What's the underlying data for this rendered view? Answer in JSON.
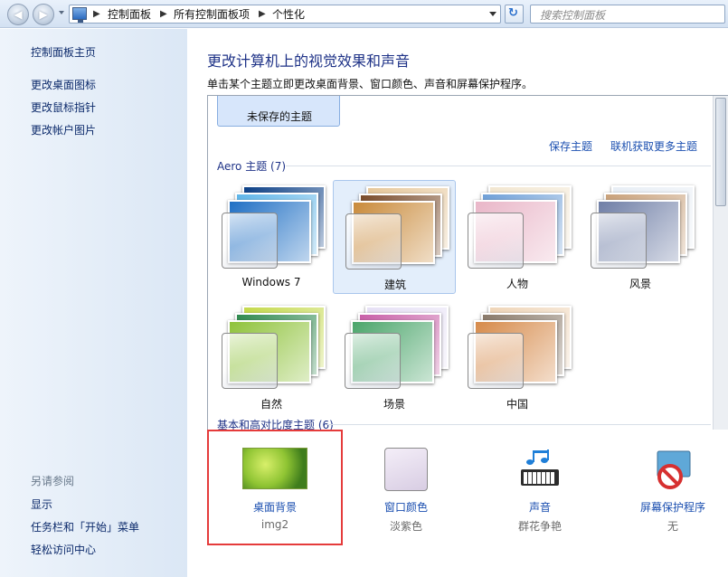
{
  "address": {
    "crumbs": [
      "控制面板",
      "所有控制面板项",
      "个性化"
    ],
    "search_placeholder": "搜索控制面板"
  },
  "sidebar": {
    "items": [
      {
        "label": "控制面板主页"
      },
      {
        "label": "更改桌面图标"
      },
      {
        "label": "更改鼠标指针"
      },
      {
        "label": "更改帐户图片"
      }
    ],
    "see_also_title": "另请参阅",
    "see_also": [
      {
        "label": "显示"
      },
      {
        "label": "任务栏和「开始」菜单"
      },
      {
        "label": "轻松访问中心"
      }
    ]
  },
  "main": {
    "title": "更改计算机上的视觉效果和声音",
    "description": "单击某个主题立即更改桌面背景、窗口颜色、声音和屏幕保护程序。",
    "unsaved_theme": "未保存的主题",
    "save_theme": "保存主题",
    "get_more": "联机获取更多主题",
    "aero_header": "Aero 主题 (7)",
    "aero_themes": [
      {
        "name": "Windows 7",
        "selected": false,
        "colors": [
          "#1f6fc4",
          "#5fb6e9",
          "#0b3f86"
        ]
      },
      {
        "name": "建筑",
        "selected": true,
        "colors": [
          "#c98a3a",
          "#7a4b2a",
          "#e6c79a"
        ]
      },
      {
        "name": "人物",
        "selected": false,
        "colors": [
          "#e9b6c8",
          "#6fa0d8",
          "#f2e6d0"
        ]
      },
      {
        "name": "风景",
        "selected": false,
        "colors": [
          "#6f7ea6",
          "#c9a17a",
          "#e8eef5"
        ]
      },
      {
        "name": "自然",
        "selected": false,
        "colors": [
          "#8ec23a",
          "#2f8a4f",
          "#c4d94a"
        ]
      },
      {
        "name": "场景",
        "selected": false,
        "colors": [
          "#4aa56a",
          "#c95fa8",
          "#e6e0f5"
        ]
      },
      {
        "name": "中国",
        "selected": false,
        "colors": [
          "#d68a4a",
          "#8a7a6a",
          "#efd5b8"
        ]
      }
    ],
    "basic_header": "基本和高对比度主题 (6)"
  },
  "bottom": [
    {
      "label": "桌面背景",
      "sub": "img2",
      "icon": "desktop-background-icon"
    },
    {
      "label": "窗口颜色",
      "sub": "淡紫色",
      "icon": "window-color-icon"
    },
    {
      "label": "声音",
      "sub": "群花争艳",
      "icon": "sound-icon"
    },
    {
      "label": "屏幕保护程序",
      "sub": "无",
      "icon": "screensaver-icon"
    }
  ],
  "colors": {
    "accent_link": "#1b4fb0",
    "title": "#1e3287",
    "highlight": "#e53b3b"
  }
}
